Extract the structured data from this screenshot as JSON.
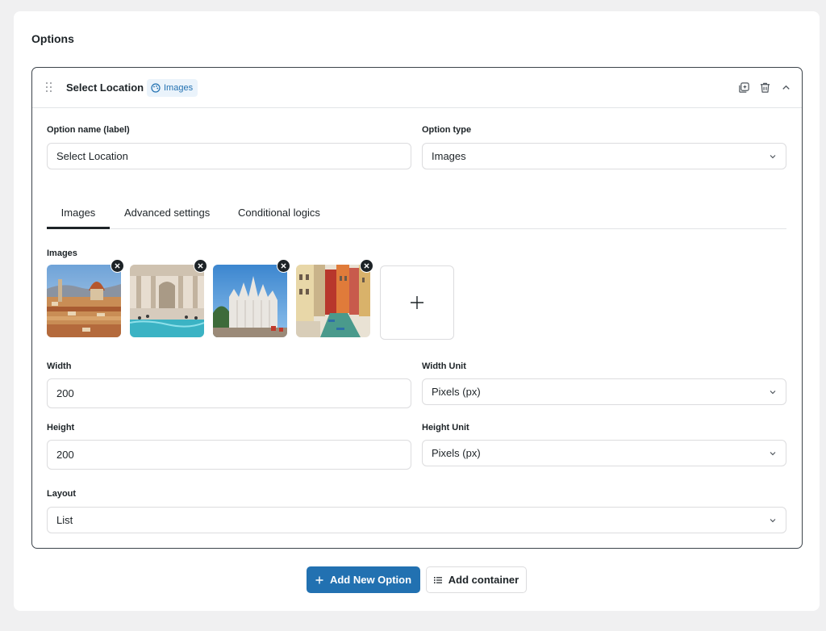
{
  "section": {
    "title": "Options"
  },
  "option": {
    "title": "Select Location",
    "type_badge": "Images",
    "icons": {
      "duplicate": "duplicate-icon",
      "delete": "trash-icon",
      "collapse": "chevron-up-icon"
    }
  },
  "fields": {
    "name_label": "Option name (label)",
    "name_value": "Select Location",
    "type_label": "Option type",
    "type_value": "Images",
    "width_label": "Width",
    "width_value": "200",
    "width_unit_label": "Width Unit",
    "width_unit_value": "Pixels (px)",
    "height_label": "Height",
    "height_value": "200",
    "height_unit_label": "Height Unit",
    "height_unit_value": "Pixels (px)",
    "layout_label": "Layout",
    "layout_value": "List"
  },
  "tabs": [
    {
      "label": "Images",
      "active": true
    },
    {
      "label": "Advanced settings",
      "active": false
    },
    {
      "label": "Conditional logics",
      "active": false
    }
  ],
  "images": {
    "label": "Images",
    "items": [
      {
        "name": "florence-cathedral-thumbnail"
      },
      {
        "name": "trevi-fountain-thumbnail"
      },
      {
        "name": "milan-cathedral-thumbnail"
      },
      {
        "name": "venice-canal-thumbnail"
      }
    ],
    "add_icon": "plus-icon"
  },
  "actions": {
    "add_option": "Add New Option",
    "add_container": "Add container"
  },
  "colors": {
    "primary": "#2271b1",
    "badge_bg": "#eaf3fb",
    "border": "#dcdcde",
    "page_bg": "#f0f0f1"
  }
}
